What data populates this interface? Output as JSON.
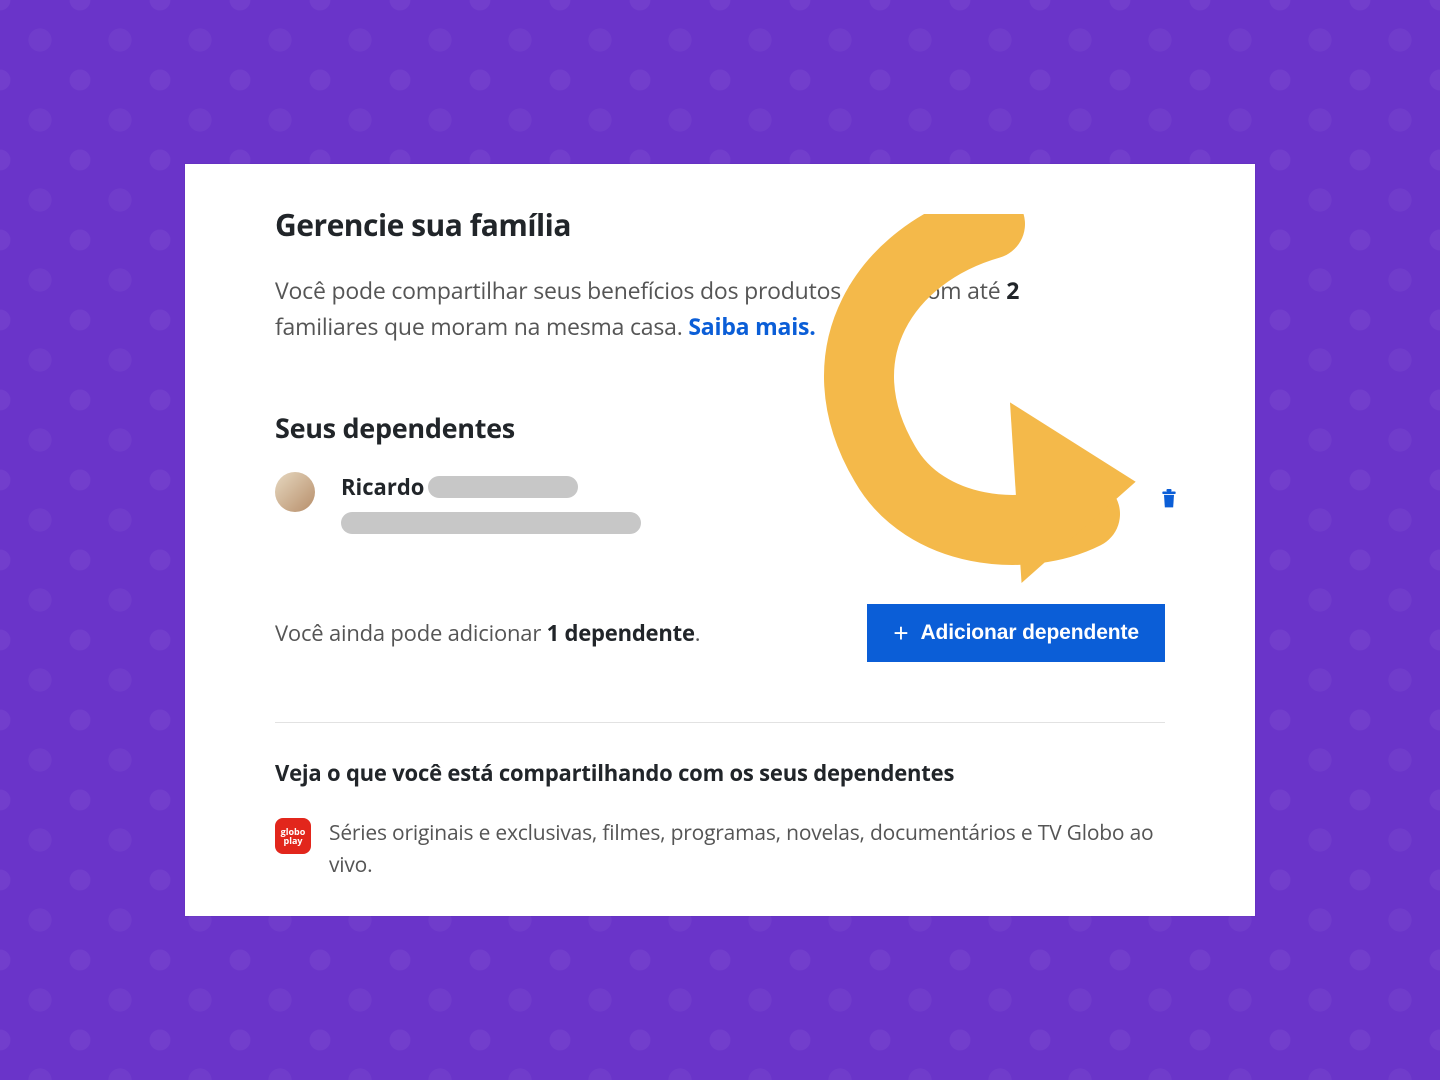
{
  "titles": {
    "main": "Gerencie sua família",
    "dependents": "Seus dependentes",
    "sharing": "Veja o que você está compartilhando com os seus dependentes"
  },
  "intro": {
    "pre": "Você pode compartilhar seus benefícios dos produtos Globo com até ",
    "count": "2",
    "post": " familiares que moram na mesma casa. ",
    "learn_more": "Saiba mais."
  },
  "dependent": {
    "name_visible": "Ricardo"
  },
  "remaining": {
    "pre": "Você ainda pode adicionar ",
    "count": "1 dependente",
    "post": "."
  },
  "buttons": {
    "add": "Adicionar dependente"
  },
  "product": {
    "badge_top": "globo",
    "badge_bottom": "play",
    "desc": "Séries originais e exclusivas, filmes, programas, novelas, documentários e TV Globo ao vivo."
  }
}
